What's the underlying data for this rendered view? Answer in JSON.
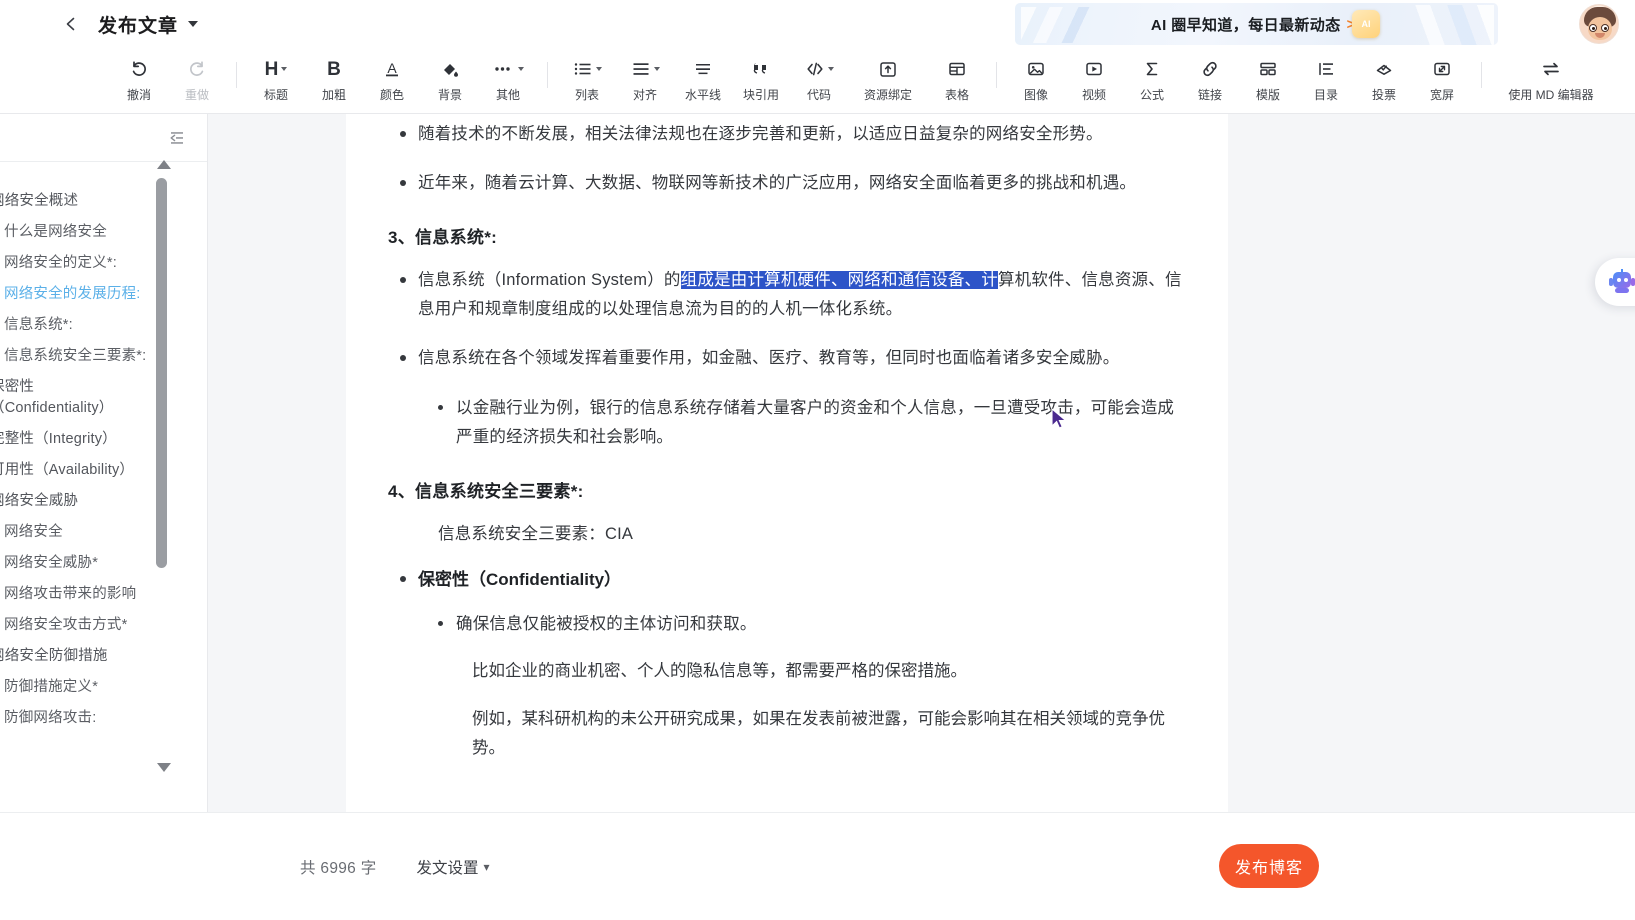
{
  "header": {
    "back_icon": "chevron-left-icon",
    "title": "发布文章",
    "caret": "chevron-down-icon",
    "banner": {
      "text": "AI 圈早知道，每日最新动态",
      "arrows": ">>",
      "chip": "AI"
    },
    "avatar_alt": "user-avatar"
  },
  "toolbar": {
    "groups": [
      {
        "items": [
          {
            "icon": "undo-icon",
            "label": "撤消",
            "disabled": false
          },
          {
            "icon": "redo-icon",
            "label": "重做",
            "disabled": true
          }
        ]
      },
      {
        "items": [
          {
            "icon": "heading-icon",
            "label": "标题",
            "caret": true
          },
          {
            "icon": "bold-icon",
            "label": "加粗"
          },
          {
            "icon": "font-color-icon",
            "label": "颜色"
          },
          {
            "icon": "background-fill-icon",
            "label": "背景"
          },
          {
            "icon": "more-dots-icon",
            "label": "其他",
            "caret": true
          }
        ]
      },
      {
        "items": [
          {
            "icon": "list-icon",
            "label": "列表",
            "caret": true
          },
          {
            "icon": "align-icon",
            "label": "对齐",
            "caret": true
          },
          {
            "icon": "horizontal-rule-icon",
            "label": "水平线"
          },
          {
            "icon": "blockquote-icon",
            "label": "块引用"
          },
          {
            "icon": "code-icon",
            "label": "代码",
            "caret": true
          },
          {
            "icon": "resource-bind-icon",
            "label": "资源绑定"
          },
          {
            "icon": "table-icon",
            "label": "表格"
          }
        ]
      },
      {
        "items": [
          {
            "icon": "image-icon",
            "label": "图像"
          },
          {
            "icon": "video-icon",
            "label": "视频"
          },
          {
            "icon": "formula-icon",
            "label": "公式"
          },
          {
            "icon": "link-icon",
            "label": "链接"
          },
          {
            "icon": "template-icon",
            "label": "模版"
          },
          {
            "icon": "toc-icon",
            "label": "目录"
          },
          {
            "icon": "vote-icon",
            "label": "投票"
          },
          {
            "icon": "fullwidth-icon",
            "label": "宽屏"
          }
        ]
      },
      {
        "items": [
          {
            "icon": "swap-icon",
            "label": "使用 MD 编辑器",
            "wide": true
          }
        ]
      }
    ]
  },
  "toc": {
    "collapse_icon": "collapse-sidebar-icon",
    "scroll_up_icon": "scroll-up-arrow",
    "scroll_down_icon": "scroll-down-arrow",
    "items": [
      {
        "label": "网络安全概述",
        "level": 1,
        "active": false
      },
      {
        "label": "什么是网络安全",
        "level": 2,
        "active": false
      },
      {
        "label": "网络安全的定义*:",
        "level": 2,
        "active": false
      },
      {
        "label": "网络安全的发展历程:",
        "level": 2,
        "active": true
      },
      {
        "label": "信息系统*:",
        "level": 2,
        "active": false
      },
      {
        "label": "信息系统安全三要素*:",
        "level": 2,
        "active": false
      },
      {
        "label": "保密性（Confidentiality）",
        "level": 1,
        "active": false,
        "wrap": true
      },
      {
        "label": "完整性（Integrity）",
        "level": 1,
        "active": false
      },
      {
        "label": "可用性（Availability）",
        "level": 1,
        "active": false
      },
      {
        "label": "网络安全威胁",
        "level": 1,
        "active": false
      },
      {
        "label": "网络安全",
        "level": 2,
        "active": false
      },
      {
        "label": "网络安全威胁*",
        "level": 2,
        "active": false
      },
      {
        "label": "网络攻击带来的影响",
        "level": 2,
        "active": false
      },
      {
        "label": "网络安全攻击方式*",
        "level": 2,
        "active": false
      },
      {
        "label": "网络安全防御措施",
        "level": 1,
        "active": false
      },
      {
        "label": "防御措施定义*",
        "level": 2,
        "active": false
      },
      {
        "label": "防御网络攻击:",
        "level": 2,
        "active": false
      }
    ]
  },
  "document": {
    "b1": "随着技术的不断发展，相关法律法规也在逐步完善和更新，以适应日益复杂的网络安全形势。",
    "b2": "近年来，随着云计算、大数据、物联网等新技术的广泛应用，网络安全面临着更多的挑战和机遇。",
    "h3": "3、信息系统*:",
    "b3_pre": "信息系统（Information System）的",
    "b3_sel": "组成是由计算机硬件、网络和通信设备、计",
    "b3_post": "算机软件、信息资源、信息用户和规章制度组成的以处理信息流为目的的人机一体化系统。",
    "b4": "信息系统在各个领域发挥着重要作用，如金融、医疗、教育等，但同时也面临着诸多安全威胁。",
    "b5": "以金融行业为例，银行的信息系统存储着大量客户的资金和个人信息，一旦遭受攻击，可能会造成严重的经济损失和社会影响。",
    "h4": "4、信息系统安全三要素*:",
    "p1": "信息系统安全三要素：CIA",
    "b6": "保密性（Confidentiality）",
    "b7": "确保信息仅能被授权的主体访问和获取。",
    "p2": "比如企业的商业机密、个人的隐私信息等，都需要严格的保密措施。",
    "p3": "例如，某科研机构的未公开研究成果，如果在发表前被泄露，可能会影响其在相关领域的竞争优势。"
  },
  "assistant": {
    "icon": "ai-robot-icon"
  },
  "footer": {
    "word_count": "共 6996 字",
    "publish_settings": "发文设置",
    "publish_settings_caret": "chevron-down-icon",
    "publish_button": "发布博客"
  },
  "colors": {
    "accent_orange": "#f4562b",
    "selection_blue": "#2d54c8",
    "toc_active": "#5bb0e8",
    "text_primary": "#35383d"
  }
}
